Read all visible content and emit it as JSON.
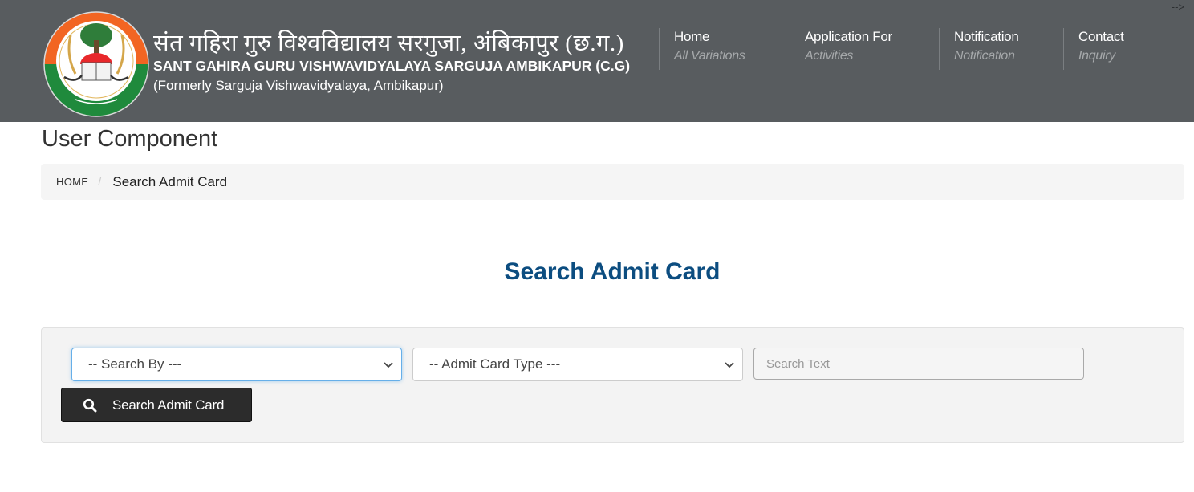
{
  "header": {
    "title_hindi": "संत गहिरा गुरु विश्वविद्यालय सरगुजा, अंबिकापुर (छ.ग.)",
    "title_english": "SANT GAHIRA GURU VISHWAVIDYALAYA SARGUJA AMBIKAPUR (C.G)",
    "subtitle": "(Formerly Sarguja Vishwavidyalaya, Ambikapur)",
    "stray_text": "-->",
    "logo_icon": "university-emblem-icon",
    "logo_colors": {
      "saffron": "#f26522",
      "green": "#1f8a3c",
      "white": "#ffffff"
    }
  },
  "nav": {
    "items": [
      {
        "label": "Home",
        "sublabel": "All Variations"
      },
      {
        "label": "Application For",
        "sublabel": "Activities"
      },
      {
        "label": "Notification",
        "sublabel": "Notification"
      },
      {
        "label": "Contact",
        "sublabel": "Inquiry"
      }
    ]
  },
  "page": {
    "title": "User Component",
    "breadcrumb": {
      "home": "HOME",
      "separator": "/",
      "current": "Search Admit Card"
    },
    "section_title": "Search Admit Card",
    "accent_color": "#0c4d80"
  },
  "form": {
    "search_by": {
      "selected": "-- Search By ---",
      "icon": "chevron-down-icon"
    },
    "admit_card_type": {
      "selected": "-- Admit Card Type ---",
      "icon": "chevron-down-icon"
    },
    "search_text": {
      "value": "",
      "placeholder": "Search Text"
    },
    "submit": {
      "label": "Search Admit Card",
      "icon": "search-icon"
    }
  }
}
